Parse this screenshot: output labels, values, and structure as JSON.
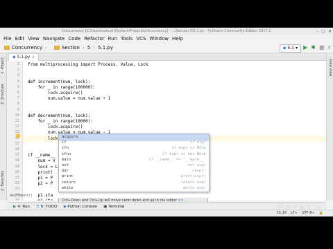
{
  "window": {
    "title": "Concurrency [C:\\Users\\sahusr\\PycharmProjects\\Concurrency] - ...\\Section 5\\5.1.py - PyCharm Community Edition 2017.2",
    "controls": [
      "–",
      "□",
      "✕"
    ]
  },
  "menu": [
    "File",
    "Edit",
    "View",
    "Navigate",
    "Code",
    "Refactor",
    "Run",
    "Tools",
    "VCS",
    "Window",
    "Help"
  ],
  "breadcrumb": [
    "Concurrency",
    "Section",
    "5",
    "5.1.py"
  ],
  "run_config": "5.1",
  "side_labels": {
    "project": "1: Project",
    "structure": "Z: Structure",
    "favorites": "2: Favorites",
    "data_view": "Data View"
  },
  "tab": {
    "label": "5.1.py"
  },
  "code_lines": [
    "from multiprocessing import Process, Value, Lock",
    "",
    "",
    "def increment(num, lock):",
    "    for _ in range(100000):",
    "        lock.acquire()",
    "        num.value = num.value + 1",
    "",
    "",
    "def decrement(num, lock):",
    "    for _ in range(10000):",
    "        lock.acquire()",
    "        num.value = num.value - 1",
    "        lock.",
    "",
    "",
    "if __name__",
    "    num = V",
    "    lock = L",
    "    print(",
    "    p1 = P",
    "    p2 = P",
    "",
    "    p1.sta",
    "    p2.sta"
  ],
  "line_numbers": [
    "1",
    "2",
    "3",
    "4",
    "5",
    "6",
    "7",
    "8",
    "9",
    "10",
    "11",
    "12",
    "13",
    "14",
    "15",
    "16",
    "17",
    "18",
    "19",
    "20",
    "21",
    "22",
    "23",
    "24",
    "25"
  ],
  "breadcrumb_bottom": "decrement()",
  "autocomplete": {
    "items": [
      {
        "name": "acquire",
        "hint": ""
      },
      {
        "name": "if",
        "hint": "if expr"
      },
      {
        "name": "ifn",
        "hint": "if expr is None"
      },
      {
        "name": "ifnn",
        "hint": "if expr is not None"
      },
      {
        "name": "main",
        "hint": "if __name__ == '__main__'"
      },
      {
        "name": "not",
        "hint": "not expr"
      },
      {
        "name": "par",
        "hint": "(expr)"
      },
      {
        "name": "print",
        "hint": "print(expr)"
      },
      {
        "name": "return",
        "hint": "return expr"
      },
      {
        "name": "while",
        "hint": "while expr"
      }
    ],
    "footer": "Ctrl+Down and Ctrl+Up will move caret down and up in the editor",
    "footer_link": ">>"
  },
  "bottom_tools": [
    {
      "icon": "run-icon",
      "label": "4: Run"
    },
    {
      "icon": "todo-icon",
      "label": "6: TODO"
    },
    {
      "icon": "python-console-icon",
      "label": "Python Console"
    },
    {
      "icon": "terminal-icon",
      "label": "Terminal"
    }
  ],
  "status": {
    "position": "15:16",
    "line_sep": "LF÷",
    "encoding": "UTF-8÷"
  },
  "brand": "Packt>",
  "colors": {
    "background": "#000000",
    "selection": "#c8d8f2",
    "current_line": "#fffae3",
    "keyword": "#000080",
    "run_green": "#2f9e44"
  }
}
